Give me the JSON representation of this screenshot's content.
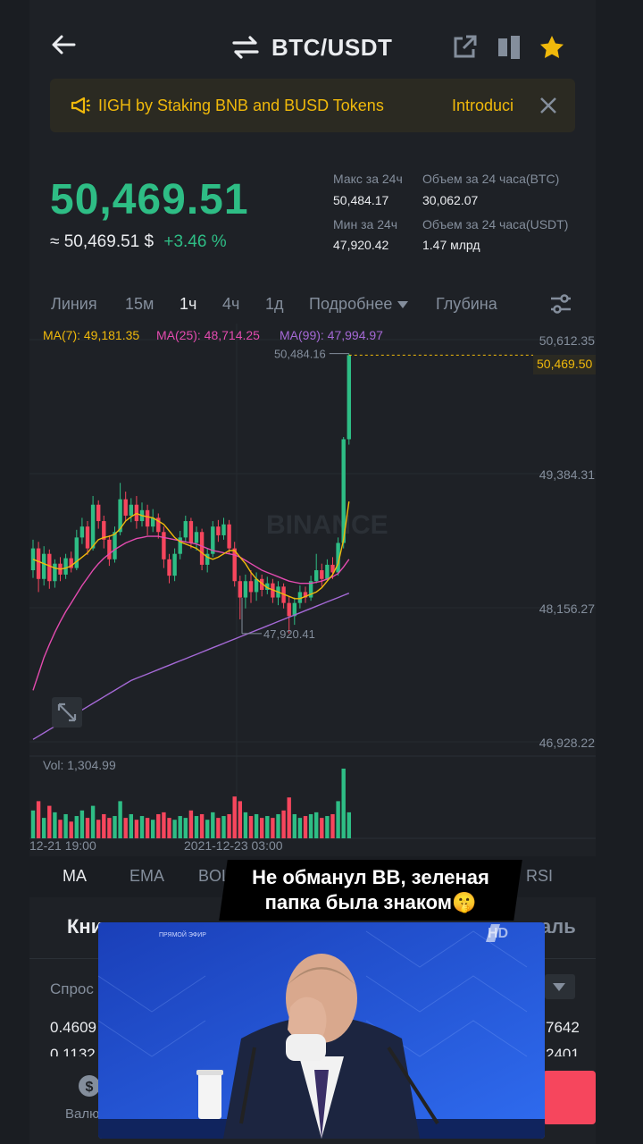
{
  "header": {
    "pair": "BTC/USDT",
    "back_icon": "arrow-left-icon",
    "swap_icon": "swap-arrows-icon",
    "share_icon": "share-external-icon",
    "layout_icon": "split-layout-icon",
    "favorite_icon": "star-icon"
  },
  "banner": {
    "text": "IIGH by Staking BNB and BUSD Tokens",
    "link": "Introduci",
    "icon": "megaphone-icon"
  },
  "ticker": {
    "last_price": "50,469.51",
    "fiat_price": "≈ 50,469.51 $",
    "change": "+3.46 %",
    "high_label": "Макс за 24ч",
    "high_value": "50,484.17",
    "low_label": "Мин за 24ч",
    "low_value": "47,920.42",
    "vol_btc_label": "Объем за 24 часа(BTC)",
    "vol_btc_value": "30,062.07",
    "vol_usdt_label": "Объем за 24 часа(USDT)",
    "vol_usdt_value": "1.47 млрд"
  },
  "timeframes": {
    "line": "Линия",
    "m15": "15м",
    "h1": "1ч",
    "h4": "4ч",
    "d1": "1д",
    "more": "Подробнее",
    "depth": "Глубина"
  },
  "chart_data": {
    "type": "candlestick",
    "ma_legend": [
      {
        "label": "MA(7): 49,181.35",
        "color": "#f0b90b"
      },
      {
        "label": "MA(25): 48,714.25",
        "color": "#e44bb0"
      },
      {
        "label": "MA(99): 47,994.97",
        "color": "#a569d6"
      }
    ],
    "y_ticks": [
      "50,612.35",
      "49,384.31",
      "48,156.27",
      "46,928.22"
    ],
    "ylim": [
      46928.22,
      50612.35
    ],
    "last_price_tag": "50,469.50",
    "high_marker": "50,484.16",
    "low_marker": "47,920.41",
    "x_ticks": [
      "12-21 19:00",
      "2021-12-23 03:00"
    ],
    "volume_label": "Vol: 1,304.99",
    "watermark": "BINANCE",
    "colors": {
      "up": "#2ebd85",
      "down": "#f6465d",
      "ma7": "#f0b90b",
      "ma25": "#e44bb0",
      "ma99": "#a569d6"
    },
    "candles": [
      {
        "o": 48500,
        "c": 48700,
        "h": 48780,
        "l": 48430
      },
      {
        "o": 48700,
        "c": 48420,
        "h": 48760,
        "l": 48300
      },
      {
        "o": 48420,
        "c": 48650,
        "h": 48720,
        "l": 48360
      },
      {
        "o": 48650,
        "c": 48400,
        "h": 48690,
        "l": 48330
      },
      {
        "o": 48400,
        "c": 48560,
        "h": 48600,
        "l": 48340
      },
      {
        "o": 48560,
        "c": 48460,
        "h": 48620,
        "l": 48400
      },
      {
        "o": 48460,
        "c": 48610,
        "h": 48650,
        "l": 48420
      },
      {
        "o": 48610,
        "c": 48520,
        "h": 48670,
        "l": 48480
      },
      {
        "o": 48520,
        "c": 48800,
        "h": 48870,
        "l": 48500
      },
      {
        "o": 48800,
        "c": 48900,
        "h": 48980,
        "l": 48740
      },
      {
        "o": 48900,
        "c": 48700,
        "h": 48950,
        "l": 48640
      },
      {
        "o": 48700,
        "c": 49100,
        "h": 49180,
        "l": 48680
      },
      {
        "o": 49100,
        "c": 48950,
        "h": 49140,
        "l": 48880
      },
      {
        "o": 48950,
        "c": 48780,
        "h": 49000,
        "l": 48700
      },
      {
        "o": 48780,
        "c": 48600,
        "h": 48820,
        "l": 48540
      },
      {
        "o": 48600,
        "c": 48850,
        "h": 48900,
        "l": 48570
      },
      {
        "o": 48850,
        "c": 49150,
        "h": 49300,
        "l": 48820
      },
      {
        "o": 49150,
        "c": 49000,
        "h": 49220,
        "l": 48950
      },
      {
        "o": 49000,
        "c": 49100,
        "h": 49160,
        "l": 48940
      },
      {
        "o": 49100,
        "c": 48950,
        "h": 49180,
        "l": 48880
      },
      {
        "o": 48950,
        "c": 49050,
        "h": 49120,
        "l": 48900
      },
      {
        "o": 49050,
        "c": 48900,
        "h": 49100,
        "l": 48820
      },
      {
        "o": 48900,
        "c": 48980,
        "h": 49060,
        "l": 48850
      },
      {
        "o": 48980,
        "c": 48850,
        "h": 49020,
        "l": 48790
      },
      {
        "o": 48850,
        "c": 48600,
        "h": 48900,
        "l": 48520
      },
      {
        "o": 48600,
        "c": 48450,
        "h": 48650,
        "l": 48380
      },
      {
        "o": 48450,
        "c": 48650,
        "h": 48700,
        "l": 48400
      },
      {
        "o": 48650,
        "c": 48800,
        "h": 48860,
        "l": 48600
      },
      {
        "o": 48800,
        "c": 48950,
        "h": 49000,
        "l": 48760
      },
      {
        "o": 48950,
        "c": 48750,
        "h": 48980,
        "l": 48700
      },
      {
        "o": 48750,
        "c": 48850,
        "h": 48900,
        "l": 48680
      },
      {
        "o": 48850,
        "c": 48550,
        "h": 48880,
        "l": 48500
      },
      {
        "o": 48550,
        "c": 48650,
        "h": 48700,
        "l": 48480
      },
      {
        "o": 48650,
        "c": 48900,
        "h": 48950,
        "l": 48620
      },
      {
        "o": 48900,
        "c": 48820,
        "h": 48960,
        "l": 48760
      },
      {
        "o": 48820,
        "c": 48920,
        "h": 48980,
        "l": 48780
      },
      {
        "o": 48920,
        "c": 48700,
        "h": 48960,
        "l": 48650
      },
      {
        "o": 48700,
        "c": 48400,
        "h": 48760,
        "l": 48350
      },
      {
        "o": 48400,
        "c": 48250,
        "h": 48450,
        "l": 48050
      },
      {
        "o": 48250,
        "c": 48400,
        "h": 48460,
        "l": 48150
      },
      {
        "o": 48400,
        "c": 48300,
        "h": 48500,
        "l": 48200
      },
      {
        "o": 48300,
        "c": 48420,
        "h": 48480,
        "l": 48220
      },
      {
        "o": 48420,
        "c": 48320,
        "h": 48460,
        "l": 48260
      },
      {
        "o": 48320,
        "c": 48380,
        "h": 48440,
        "l": 48280
      },
      {
        "o": 48380,
        "c": 48250,
        "h": 48420,
        "l": 48200
      },
      {
        "o": 48250,
        "c": 48350,
        "h": 48400,
        "l": 48180
      },
      {
        "o": 48350,
        "c": 48200,
        "h": 48380,
        "l": 48150
      },
      {
        "o": 48200,
        "c": 48080,
        "h": 48260,
        "l": 47920
      },
      {
        "o": 48080,
        "c": 48200,
        "h": 48250,
        "l": 48000
      },
      {
        "o": 48200,
        "c": 48300,
        "h": 48360,
        "l": 48150
      },
      {
        "o": 48300,
        "c": 48250,
        "h": 48350,
        "l": 48200
      },
      {
        "o": 48250,
        "c": 48400,
        "h": 48450,
        "l": 48220
      },
      {
        "o": 48400,
        "c": 48500,
        "h": 48650,
        "l": 48380
      },
      {
        "o": 48500,
        "c": 48420,
        "h": 48560,
        "l": 48350
      },
      {
        "o": 48420,
        "c": 48550,
        "h": 48600,
        "l": 48400
      },
      {
        "o": 48550,
        "c": 48480,
        "h": 48620,
        "l": 48420
      },
      {
        "o": 48480,
        "c": 48750,
        "h": 48800,
        "l": 48450
      },
      {
        "o": 48750,
        "c": 49700,
        "h": 49720,
        "l": 48700
      },
      {
        "o": 49700,
        "c": 50470,
        "h": 50484,
        "l": 49650
      }
    ],
    "ma7": [
      48600,
      48580,
      48560,
      48540,
      48520,
      48510,
      48520,
      48540,
      48580,
      48620,
      48660,
      48720,
      48780,
      48800,
      48810,
      48830,
      48880,
      48950,
      48990,
      49020,
      49000,
      48990,
      48980,
      48950,
      48920,
      48860,
      48800,
      48760,
      48740,
      48720,
      48700,
      48660,
      48620,
      48600,
      48620,
      48650,
      48680,
      48680,
      48620,
      48560,
      48480,
      48420,
      48380,
      48340,
      48320,
      48300,
      48280,
      48260,
      48240,
      48240,
      48260,
      48280,
      48300,
      48340,
      48400,
      48460,
      48560,
      48780,
      49130
    ],
    "ma25": [
      47400,
      47550,
      47700,
      47820,
      47930,
      48030,
      48120,
      48200,
      48280,
      48360,
      48430,
      48500,
      48560,
      48610,
      48650,
      48690,
      48720,
      48750,
      48770,
      48790,
      48800,
      48810,
      48810,
      48810,
      48800,
      48790,
      48780,
      48770,
      48760,
      48750,
      48740,
      48720,
      48700,
      48680,
      48670,
      48660,
      48650,
      48640,
      48620,
      48590,
      48560,
      48530,
      48500,
      48480,
      48460,
      48440,
      48420,
      48400,
      48390,
      48380,
      48380,
      48380,
      48390,
      48400,
      48420,
      48440,
      48470,
      48530,
      48600
    ],
    "ma99": [
      46950,
      46980,
      47010,
      47040,
      47070,
      47100,
      47130,
      47160,
      47190,
      47220,
      47250,
      47280,
      47310,
      47340,
      47370,
      47400,
      47430,
      47460,
      47490,
      47510,
      47530,
      47550,
      47570,
      47590,
      47610,
      47630,
      47650,
      47670,
      47690,
      47710,
      47730,
      47750,
      47770,
      47790,
      47810,
      47830,
      47850,
      47870,
      47890,
      47910,
      47930,
      47950,
      47970,
      47990,
      48010,
      48030,
      48050,
      48070,
      48090,
      48110,
      48130,
      48150,
      48170,
      48190,
      48210,
      48230,
      48250,
      48270,
      48290
    ],
    "volumes": [
      30,
      40,
      22,
      35,
      28,
      20,
      26,
      18,
      24,
      30,
      22,
      35,
      20,
      26,
      22,
      24,
      40,
      22,
      26,
      20,
      24,
      22,
      20,
      26,
      28,
      22,
      20,
      24,
      22,
      30,
      24,
      26,
      20,
      28,
      22,
      24,
      26,
      45,
      40,
      28,
      24,
      26,
      22,
      24,
      22,
      26,
      30,
      44,
      26,
      22,
      24,
      26,
      28,
      22,
      24,
      26,
      40,
      75,
      28
    ]
  },
  "indicators": {
    "ma": "MA",
    "ema": "EMA",
    "boll": "BOLL",
    "rsi": "RSI"
  },
  "caption": {
    "line1": "Не обманул ВВ, зеленая",
    "line2": "папка была знаком🤫"
  },
  "orderbook": {
    "title": "Кни",
    "title_right": "аль",
    "bid_label": "Спрос",
    "row1_left": "0.4609",
    "row1_right": "7642",
    "row2_left": "0.1132",
    "row2_right": "2401"
  },
  "video": {
    "live_label": "ПРЯМОЙ ЭФИР",
    "channel": "HD"
  },
  "bottom_nav": {
    "item1": "Валю"
  }
}
